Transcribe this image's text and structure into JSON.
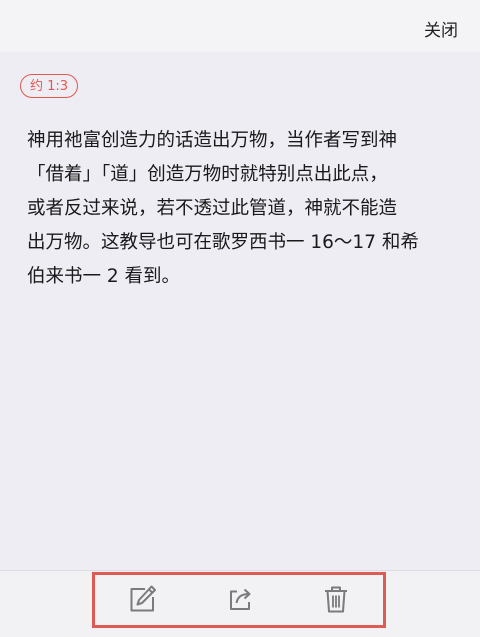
{
  "header": {
    "close_label": "关闭"
  },
  "note": {
    "reference_tag": "约 1:3",
    "text": "神用祂富创造力的话造出万物，当作者写到神\n「借着」「道」创造万物时就特别点出此点，\n或者反过来说，若不透过此管道，神就不能造\n出万物。这教导也可在歌罗西书一 16～17 和希\n伯来书一 2 看到。"
  },
  "toolbar": {
    "icons": [
      "edit-icon",
      "share-icon",
      "trash-icon"
    ]
  },
  "colors": {
    "accent_red": "#e4574f",
    "highlight_border": "#de5a54",
    "background": "#eeedf4",
    "icon_gray": "#7b7b7b"
  }
}
